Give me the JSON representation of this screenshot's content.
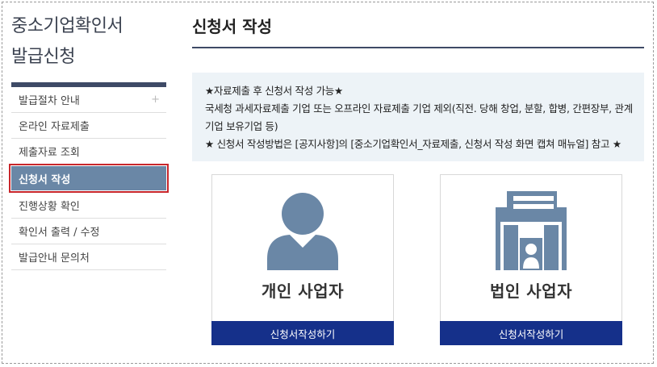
{
  "sidebar": {
    "title_line1": "중소기업확인서",
    "title_line2": "발급신청",
    "items": [
      {
        "label": "발급절차 안내",
        "expand_icon": "+"
      },
      {
        "label": "온라인 자료제출"
      },
      {
        "label": "제출자료 조회"
      },
      {
        "label": "신청서 작성"
      },
      {
        "label": "진행상황 확인"
      },
      {
        "label": "확인서 출력 / 수정"
      },
      {
        "label": "발급안내 문의처"
      }
    ]
  },
  "main": {
    "title": "신청서 작성",
    "notice": {
      "line1": "★자료제출 후 신청서 작성 가능★",
      "line2": "국세청 과세자료제출 기업 또는 오프라인 자료제출 기업 제외(직전. 당해 창업, 분할, 합병, 간편장부, 관계기업 보유기업 등)",
      "line3": "★ 신청서 작성방법은 [공지사항]의 [중소기업확인서_자료제출, 신청서 작성 화면 캡쳐 매뉴얼] 참고 ★"
    },
    "cards": [
      {
        "label": "개인 사업자",
        "button": "신청서작성하기",
        "icon": "person-icon"
      },
      {
        "label": "법인 사업자",
        "button": "신청서작성하기",
        "icon": "building-icon"
      }
    ]
  },
  "colors": {
    "accent_navy": "#15308a",
    "active_menu": "#6a87a6",
    "highlight_border": "#c8262b",
    "icon_fill": "#6a87a6"
  }
}
